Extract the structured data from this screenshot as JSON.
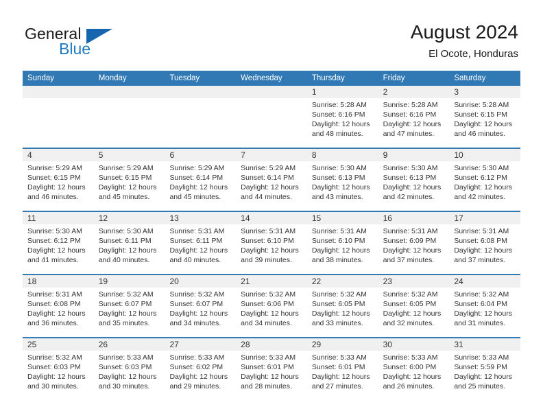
{
  "brand": {
    "word_one": "General",
    "word_two": "Blue",
    "logo_icon": "triangle-flag-icon",
    "accent_color": "#1566ae",
    "text_color": "#1f7ac4"
  },
  "header": {
    "title": "August 2024",
    "subtitle": "El Ocote, Honduras"
  },
  "theme": {
    "header_blue": "#3179b4",
    "daynum_band": "#f0f0f0",
    "rule_blue": "#3179b4",
    "body_bg": "#ffffff",
    "text": "#333333"
  },
  "weekdays": [
    "Sunday",
    "Monday",
    "Tuesday",
    "Wednesday",
    "Thursday",
    "Friday",
    "Saturday"
  ],
  "weeks": [
    [
      {
        "day": "",
        "lines": []
      },
      {
        "day": "",
        "lines": []
      },
      {
        "day": "",
        "lines": []
      },
      {
        "day": "",
        "lines": []
      },
      {
        "day": "1",
        "lines": [
          "Sunrise: 5:28 AM",
          "Sunset: 6:16 PM",
          "Daylight: 12 hours",
          "and 48 minutes."
        ]
      },
      {
        "day": "2",
        "lines": [
          "Sunrise: 5:28 AM",
          "Sunset: 6:16 PM",
          "Daylight: 12 hours",
          "and 47 minutes."
        ]
      },
      {
        "day": "3",
        "lines": [
          "Sunrise: 5:28 AM",
          "Sunset: 6:15 PM",
          "Daylight: 12 hours",
          "and 46 minutes."
        ]
      }
    ],
    [
      {
        "day": "4",
        "lines": [
          "Sunrise: 5:29 AM",
          "Sunset: 6:15 PM",
          "Daylight: 12 hours",
          "and 46 minutes."
        ]
      },
      {
        "day": "5",
        "lines": [
          "Sunrise: 5:29 AM",
          "Sunset: 6:15 PM",
          "Daylight: 12 hours",
          "and 45 minutes."
        ]
      },
      {
        "day": "6",
        "lines": [
          "Sunrise: 5:29 AM",
          "Sunset: 6:14 PM",
          "Daylight: 12 hours",
          "and 45 minutes."
        ]
      },
      {
        "day": "7",
        "lines": [
          "Sunrise: 5:29 AM",
          "Sunset: 6:14 PM",
          "Daylight: 12 hours",
          "and 44 minutes."
        ]
      },
      {
        "day": "8",
        "lines": [
          "Sunrise: 5:30 AM",
          "Sunset: 6:13 PM",
          "Daylight: 12 hours",
          "and 43 minutes."
        ]
      },
      {
        "day": "9",
        "lines": [
          "Sunrise: 5:30 AM",
          "Sunset: 6:13 PM",
          "Daylight: 12 hours",
          "and 42 minutes."
        ]
      },
      {
        "day": "10",
        "lines": [
          "Sunrise: 5:30 AM",
          "Sunset: 6:12 PM",
          "Daylight: 12 hours",
          "and 42 minutes."
        ]
      }
    ],
    [
      {
        "day": "11",
        "lines": [
          "Sunrise: 5:30 AM",
          "Sunset: 6:12 PM",
          "Daylight: 12 hours",
          "and 41 minutes."
        ]
      },
      {
        "day": "12",
        "lines": [
          "Sunrise: 5:30 AM",
          "Sunset: 6:11 PM",
          "Daylight: 12 hours",
          "and 40 minutes."
        ]
      },
      {
        "day": "13",
        "lines": [
          "Sunrise: 5:31 AM",
          "Sunset: 6:11 PM",
          "Daylight: 12 hours",
          "and 40 minutes."
        ]
      },
      {
        "day": "14",
        "lines": [
          "Sunrise: 5:31 AM",
          "Sunset: 6:10 PM",
          "Daylight: 12 hours",
          "and 39 minutes."
        ]
      },
      {
        "day": "15",
        "lines": [
          "Sunrise: 5:31 AM",
          "Sunset: 6:10 PM",
          "Daylight: 12 hours",
          "and 38 minutes."
        ]
      },
      {
        "day": "16",
        "lines": [
          "Sunrise: 5:31 AM",
          "Sunset: 6:09 PM",
          "Daylight: 12 hours",
          "and 37 minutes."
        ]
      },
      {
        "day": "17",
        "lines": [
          "Sunrise: 5:31 AM",
          "Sunset: 6:08 PM",
          "Daylight: 12 hours",
          "and 37 minutes."
        ]
      }
    ],
    [
      {
        "day": "18",
        "lines": [
          "Sunrise: 5:31 AM",
          "Sunset: 6:08 PM",
          "Daylight: 12 hours",
          "and 36 minutes."
        ]
      },
      {
        "day": "19",
        "lines": [
          "Sunrise: 5:32 AM",
          "Sunset: 6:07 PM",
          "Daylight: 12 hours",
          "and 35 minutes."
        ]
      },
      {
        "day": "20",
        "lines": [
          "Sunrise: 5:32 AM",
          "Sunset: 6:07 PM",
          "Daylight: 12 hours",
          "and 34 minutes."
        ]
      },
      {
        "day": "21",
        "lines": [
          "Sunrise: 5:32 AM",
          "Sunset: 6:06 PM",
          "Daylight: 12 hours",
          "and 34 minutes."
        ]
      },
      {
        "day": "22",
        "lines": [
          "Sunrise: 5:32 AM",
          "Sunset: 6:05 PM",
          "Daylight: 12 hours",
          "and 33 minutes."
        ]
      },
      {
        "day": "23",
        "lines": [
          "Sunrise: 5:32 AM",
          "Sunset: 6:05 PM",
          "Daylight: 12 hours",
          "and 32 minutes."
        ]
      },
      {
        "day": "24",
        "lines": [
          "Sunrise: 5:32 AM",
          "Sunset: 6:04 PM",
          "Daylight: 12 hours",
          "and 31 minutes."
        ]
      }
    ],
    [
      {
        "day": "25",
        "lines": [
          "Sunrise: 5:32 AM",
          "Sunset: 6:03 PM",
          "Daylight: 12 hours",
          "and 30 minutes."
        ]
      },
      {
        "day": "26",
        "lines": [
          "Sunrise: 5:33 AM",
          "Sunset: 6:03 PM",
          "Daylight: 12 hours",
          "and 30 minutes."
        ]
      },
      {
        "day": "27",
        "lines": [
          "Sunrise: 5:33 AM",
          "Sunset: 6:02 PM",
          "Daylight: 12 hours",
          "and 29 minutes."
        ]
      },
      {
        "day": "28",
        "lines": [
          "Sunrise: 5:33 AM",
          "Sunset: 6:01 PM",
          "Daylight: 12 hours",
          "and 28 minutes."
        ]
      },
      {
        "day": "29",
        "lines": [
          "Sunrise: 5:33 AM",
          "Sunset: 6:01 PM",
          "Daylight: 12 hours",
          "and 27 minutes."
        ]
      },
      {
        "day": "30",
        "lines": [
          "Sunrise: 5:33 AM",
          "Sunset: 6:00 PM",
          "Daylight: 12 hours",
          "and 26 minutes."
        ]
      },
      {
        "day": "31",
        "lines": [
          "Sunrise: 5:33 AM",
          "Sunset: 5:59 PM",
          "Daylight: 12 hours",
          "and 25 minutes."
        ]
      }
    ]
  ]
}
